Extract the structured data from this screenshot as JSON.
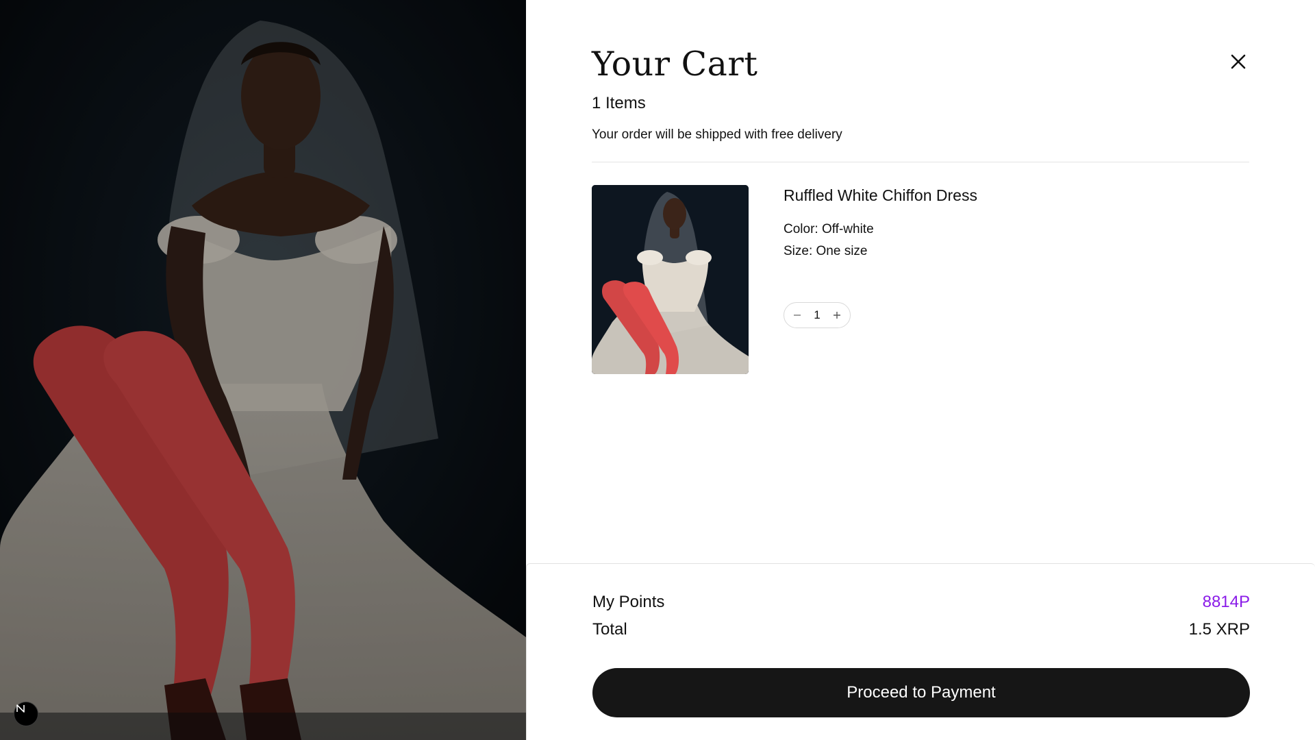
{
  "cart": {
    "title": "Your Cart",
    "item_count": "1 Items",
    "shipping_note": "Your order will be shipped with free delivery",
    "close_icon": "close-icon"
  },
  "items": [
    {
      "name": "Ruffled White Chiffon Dress",
      "color": "Color: Off-white",
      "size": "Size: One size",
      "quantity": "1",
      "decrement_icon": "minus-icon",
      "increment_icon": "plus-icon"
    }
  ],
  "summary": {
    "points_label": "My Points",
    "points_value": "8814P",
    "total_label": "Total",
    "total_value": "1.5 XRP",
    "pay_label": "Proceed to Payment"
  },
  "badge": {
    "letter": "N"
  },
  "colors": {
    "accent_points": "#8a1be8",
    "button_bg": "#161616",
    "drawer_bg": "#ffffff"
  }
}
